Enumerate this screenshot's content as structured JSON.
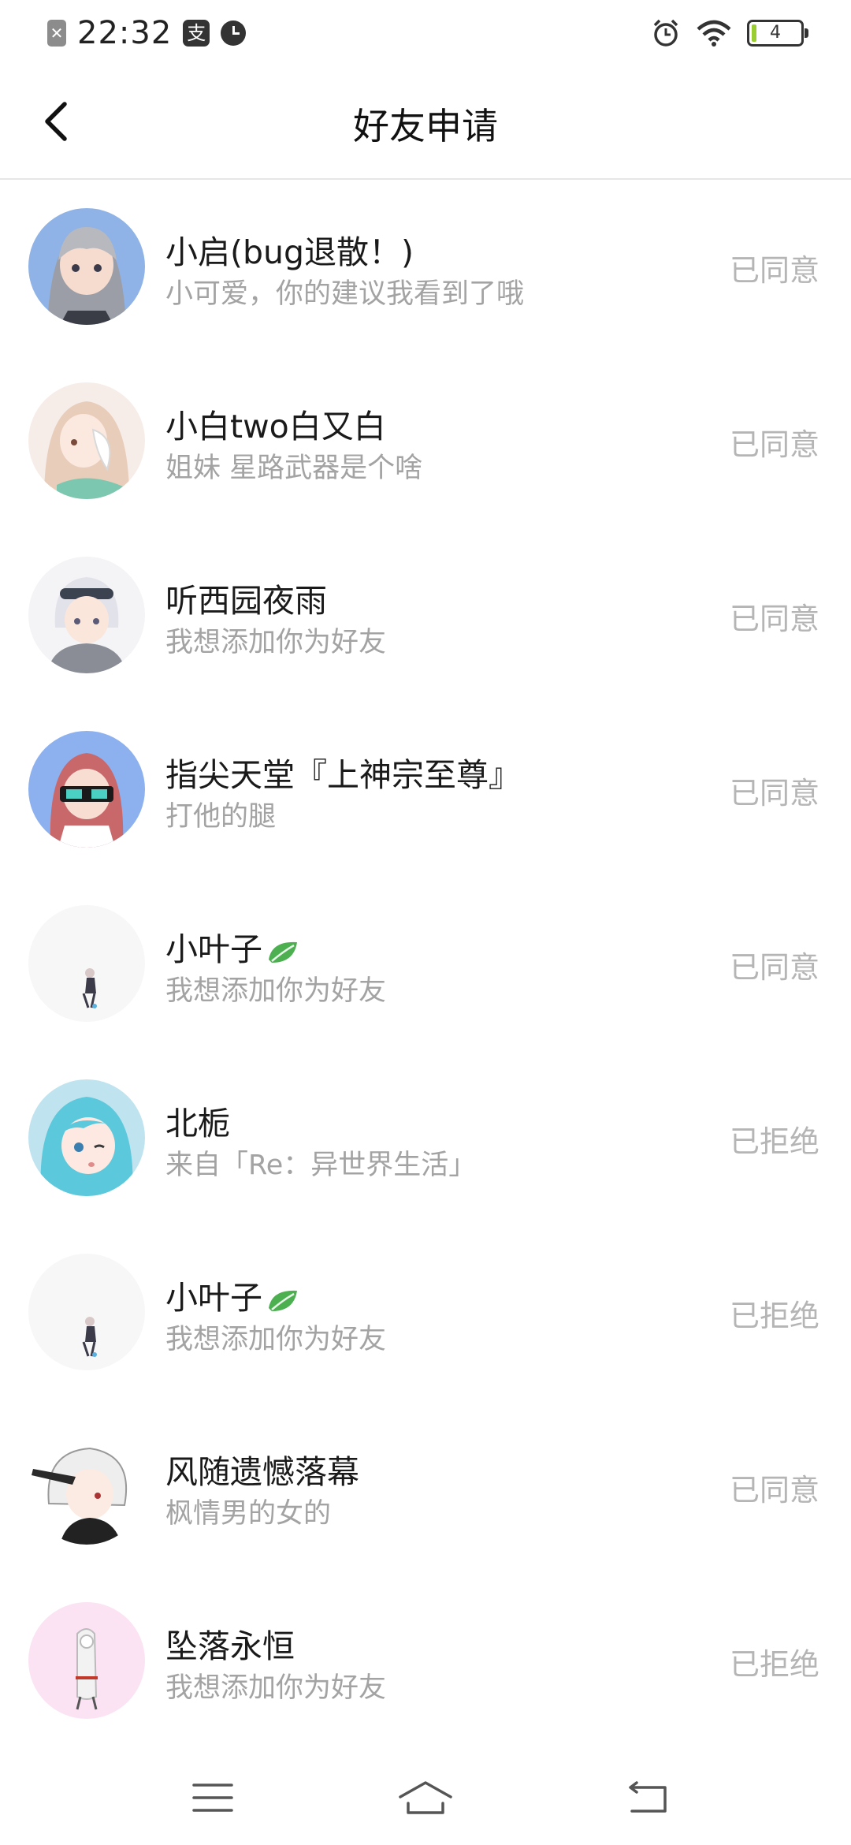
{
  "status_bar": {
    "time": "22:32",
    "pay_icon_text": "支",
    "battery": "4",
    "icons": [
      "notification-x-icon",
      "alipay-icon",
      "alarm-icon",
      "alarm-clock-icon",
      "wifi-icon",
      "battery-icon"
    ]
  },
  "header": {
    "title": "好友申请",
    "back_icon": "chevron-left-icon"
  },
  "requests": [
    {
      "name": "小启(bug退散！)",
      "message": "小可爱，你的建议我看到了哦",
      "status": "已同意"
    },
    {
      "name": "小白two白又白",
      "message": "姐妹 星路武器是个啥",
      "status": "已同意"
    },
    {
      "name": "听西园夜雨",
      "message": "我想添加你为好友",
      "status": "已同意"
    },
    {
      "name": "指尖天堂『上神宗至尊』",
      "message": "打他的腿",
      "status": "已同意"
    },
    {
      "name": "小叶子",
      "message": "我想添加你为好友",
      "status": "已同意"
    },
    {
      "name": "北栀",
      "message": "来自「Re：异世界生活」",
      "status": "已拒绝"
    },
    {
      "name": "小叶子",
      "message": "我想添加你为好友",
      "status": "已拒绝"
    },
    {
      "name": "风随遗憾落幕",
      "message": "枫情男的女的",
      "status": "已同意"
    },
    {
      "name": "坠落永恒",
      "message": "我想添加你为好友",
      "status": "已拒绝"
    }
  ],
  "nav_bar": {
    "icons": [
      "menu-icon",
      "home-icon",
      "back-icon"
    ]
  },
  "colors": {
    "background": "#ffffff",
    "text_primary": "#1a1a1a",
    "text_secondary": "#a3a3a3",
    "status_text": "#b5b5b5",
    "divider": "#e6e6e6",
    "leaf_green": "#4caf50"
  }
}
